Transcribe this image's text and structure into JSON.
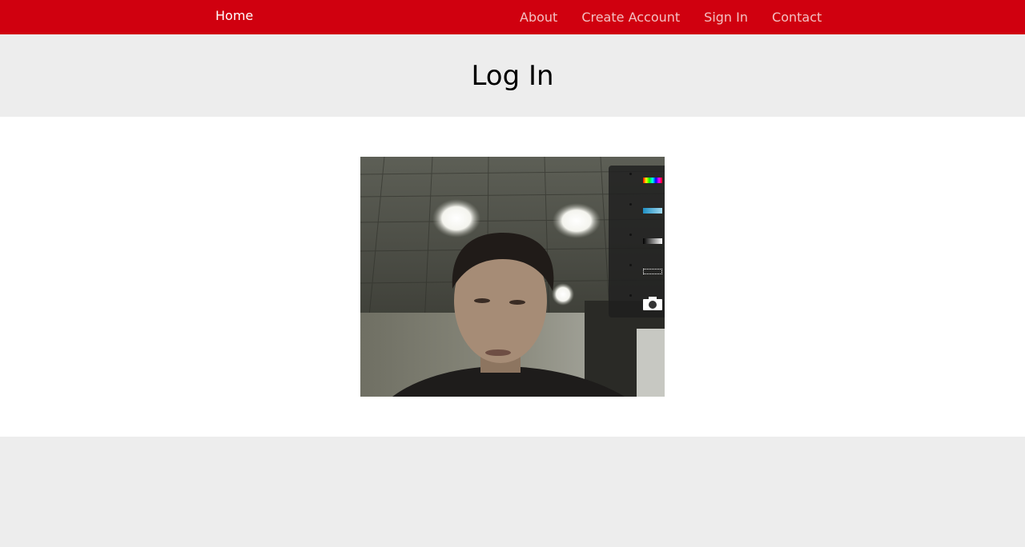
{
  "nav": {
    "brand": "Home",
    "links": [
      "About",
      "Create Account",
      "Sign In",
      "Contact"
    ]
  },
  "page": {
    "title": "Log In"
  },
  "webcam": {
    "toolbar": [
      {
        "name": "rainbow-filter-icon"
      },
      {
        "name": "blue-tint-filter-icon"
      },
      {
        "name": "grayscale-filter-icon"
      },
      {
        "name": "dotted-frame-icon"
      },
      {
        "name": "camera-icon"
      }
    ]
  },
  "colors": {
    "nav_background": "#d0000f",
    "band_background": "#ededed"
  }
}
